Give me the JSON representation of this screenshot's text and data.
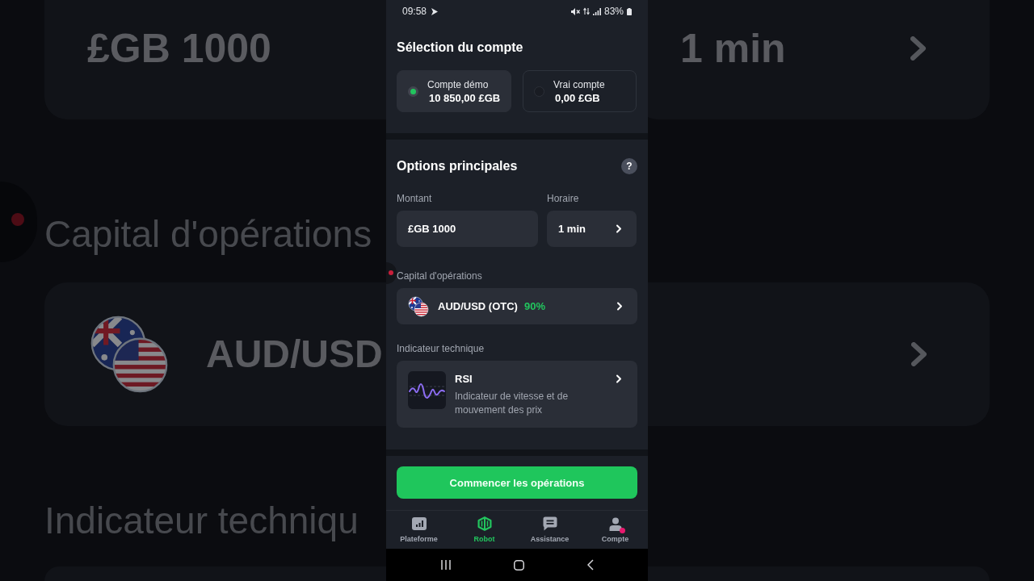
{
  "status_bar": {
    "time": "09:58",
    "battery": "83%"
  },
  "account_selection": {
    "title": "Sélection du compte",
    "accounts": [
      {
        "name": "Compte démo",
        "balance": "10 850,00 £GB",
        "selected": true
      },
      {
        "name": "Vrai compte",
        "balance": "0,00 £GB",
        "selected": false
      }
    ]
  },
  "main_options": {
    "title": "Options principales",
    "help": "?",
    "amount": {
      "label": "Montant",
      "value": "£GB 1000"
    },
    "duration": {
      "label": "Horaire",
      "value": "1 min"
    },
    "asset": {
      "label": "Capital d'opérations",
      "name": "AUD/USD (OTC)",
      "payout": "90%"
    },
    "indicator": {
      "label": "Indicateur technique",
      "name": "RSI",
      "description": "Indicateur de vitesse et de mouvement des prix"
    }
  },
  "start_button": {
    "label": "Commencer les opérations"
  },
  "bottom_nav": [
    {
      "label": "Plateforme",
      "selected": false,
      "badge": false
    },
    {
      "label": "Robot",
      "selected": true,
      "badge": false
    },
    {
      "label": "Assistance",
      "selected": false,
      "badge": false
    },
    {
      "label": "Compte",
      "selected": false,
      "badge": true
    }
  ],
  "backdrop": {
    "amount": "£GB 1000",
    "duration": "1 min",
    "asset_label": "Capital d'opérations",
    "asset": "AUD/USD",
    "indicator_label": "Indicateur techniqu"
  }
}
